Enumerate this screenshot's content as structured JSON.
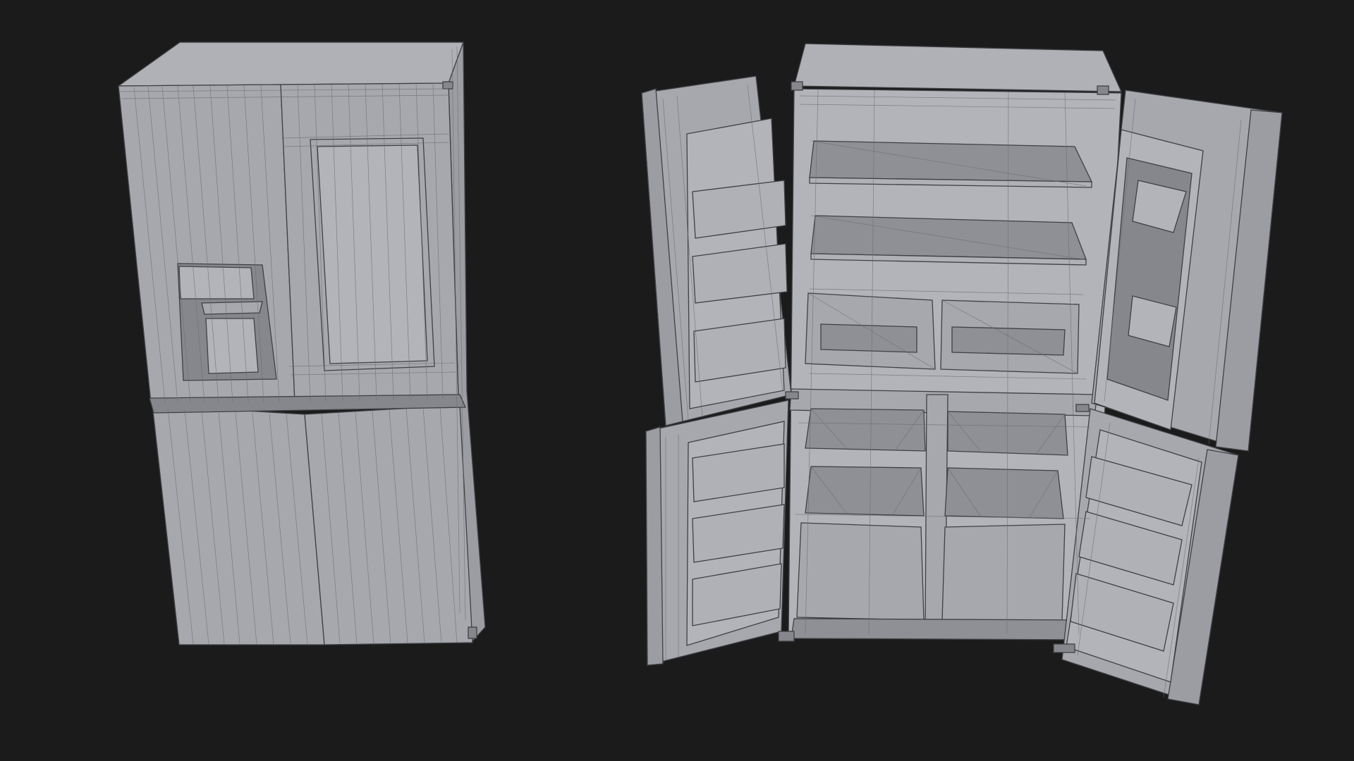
{
  "scene": {
    "background_color": "#1b1b1c",
    "model_color": "#a7a8ae",
    "wire_color": "#6a6b70",
    "objects": [
      {
        "id": "closed",
        "state": "doors closed"
      },
      {
        "id": "open",
        "state": "doors open"
      }
    ]
  }
}
